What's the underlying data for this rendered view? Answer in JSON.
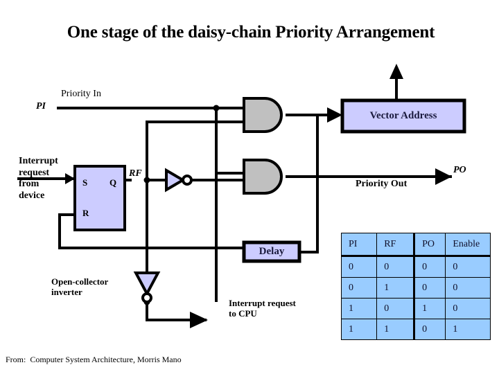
{
  "title": "One stage of the daisy-chain Priority Arrangement",
  "diagram": {
    "priority_in_label": "Priority In",
    "pi_label": "PI",
    "interrupt_request_from_device": "Interrupt\nrequest\nfrom\ndevice",
    "flipflop": {
      "s_label": "S",
      "q_label": "Q",
      "r_label": "R"
    },
    "rf_label": "RF",
    "vector_address_label": "Vector Address",
    "po_label": "PO",
    "priority_out_label": "Priority Out",
    "delay_label": "Delay",
    "open_collector_inverter_label": "Open-collector\ninverter",
    "interrupt_request_to_cpu_label": "Interrupt request\nto CPU"
  },
  "truth_table": {
    "headers": [
      "PI",
      "RF",
      "PO",
      "Enable"
    ],
    "rows": [
      [
        "0",
        "0",
        "0",
        "0"
      ],
      [
        "0",
        "1",
        "0",
        "0"
      ],
      [
        "1",
        "0",
        "1",
        "0"
      ],
      [
        "1",
        "1",
        "0",
        "1"
      ]
    ]
  },
  "source": "From:  Computer System Architecture, Morris Mano",
  "colors": {
    "wire": "#000000",
    "and_gate_fill": "#c0c0c0",
    "box_fill": "#ccccff",
    "table_fill": "#99ccff",
    "background": "#ffffff"
  }
}
